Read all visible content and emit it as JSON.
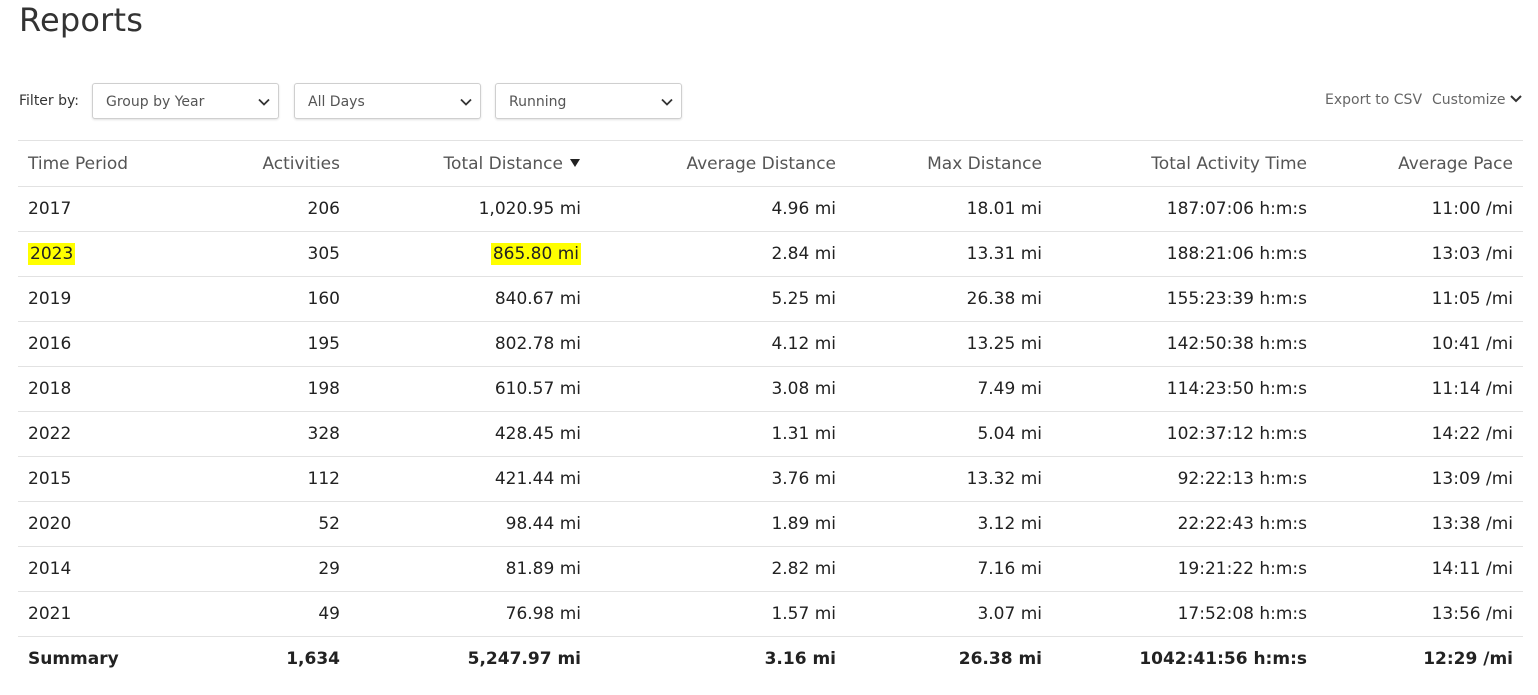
{
  "page": {
    "title": "Reports"
  },
  "filters": {
    "label": "Filter by:",
    "group": "Group by Year",
    "days": "All Days",
    "activity": "Running"
  },
  "actions": {
    "export": "Export to CSV",
    "customize": "Customize"
  },
  "table": {
    "columns": [
      "Time Period",
      "Activities",
      "Total Distance",
      "Average Distance",
      "Max Distance",
      "Total Activity Time",
      "Average Pace"
    ],
    "sorted_column": "Total Distance",
    "sort_direction": "descending",
    "rows": [
      [
        "2017",
        "206",
        "1,020.95 mi",
        "4.96 mi",
        "18.01 mi",
        "187:07:06 h:m:s",
        "11:00 /mi"
      ],
      [
        "2023",
        "305",
        "865.80 mi",
        "2.84 mi",
        "13.31 mi",
        "188:21:06 h:m:s",
        "13:03 /mi"
      ],
      [
        "2019",
        "160",
        "840.67 mi",
        "5.25 mi",
        "26.38 mi",
        "155:23:39 h:m:s",
        "11:05 /mi"
      ],
      [
        "2016",
        "195",
        "802.78 mi",
        "4.12 mi",
        "13.25 mi",
        "142:50:38 h:m:s",
        "10:41 /mi"
      ],
      [
        "2018",
        "198",
        "610.57 mi",
        "3.08 mi",
        "7.49 mi",
        "114:23:50 h:m:s",
        "11:14 /mi"
      ],
      [
        "2022",
        "328",
        "428.45 mi",
        "1.31 mi",
        "5.04 mi",
        "102:37:12 h:m:s",
        "14:22 /mi"
      ],
      [
        "2015",
        "112",
        "421.44 mi",
        "3.76 mi",
        "13.32 mi",
        "92:22:13 h:m:s",
        "13:09 /mi"
      ],
      [
        "2020",
        "52",
        "98.44 mi",
        "1.89 mi",
        "3.12 mi",
        "22:22:43 h:m:s",
        "13:38 /mi"
      ],
      [
        "2014",
        "29",
        "81.89 mi",
        "2.82 mi",
        "7.16 mi",
        "19:21:22 h:m:s",
        "14:11 /mi"
      ],
      [
        "2021",
        "49",
        "76.98 mi",
        "1.57 mi",
        "3.07 mi",
        "17:52:08 h:m:s",
        "13:56 /mi"
      ]
    ],
    "summary": [
      "Summary",
      "1,634",
      "5,247.97 mi",
      "3.16 mi",
      "26.38 mi",
      "1042:41:56 h:m:s",
      "12:29 /mi"
    ]
  },
  "highlight": {
    "row": "2023",
    "color": "#ffff00"
  },
  "icons": {
    "select_chevron": "chevron-down-icon",
    "sort": "sort-descending-icon"
  }
}
